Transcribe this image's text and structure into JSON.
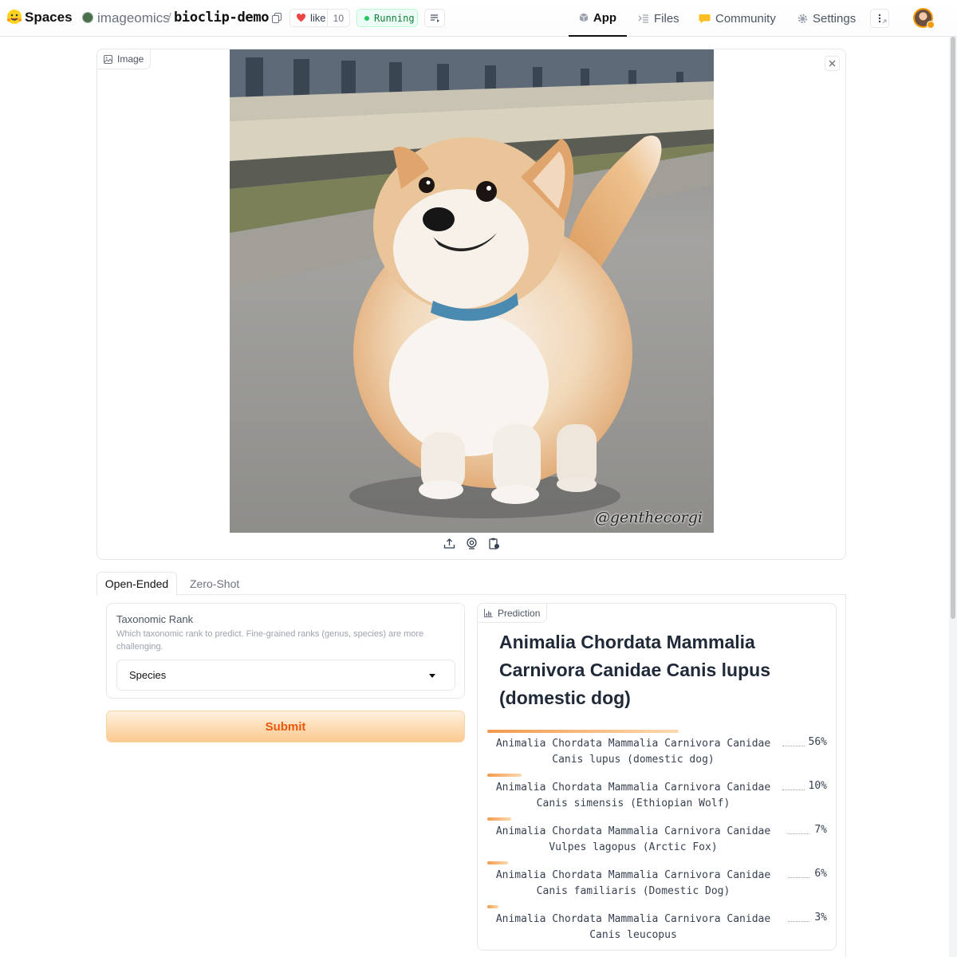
{
  "header": {
    "brand": "Spaces",
    "org": "imageomics",
    "separator": "/",
    "repo": "bioclip-demo",
    "like_label": "like",
    "like_count": "10",
    "status": "Running",
    "nav": {
      "app": "App",
      "files": "Files",
      "community": "Community",
      "settings": "Settings"
    }
  },
  "image_panel": {
    "label": "Image",
    "watermark": "@genthecorgi"
  },
  "tabs": {
    "open_ended": "Open-Ended",
    "zero_shot": "Zero-Shot"
  },
  "form": {
    "rank_title": "Taxonomic Rank",
    "rank_info": "Which taxonomic rank to predict. Fine-grained ranks (genus, species) are more challenging.",
    "rank_value": "Species",
    "submit": "Submit"
  },
  "prediction": {
    "label": "Prediction",
    "top": "Animalia Chordata Mammalia Carnivora Canidae Canis lupus (domestic dog)",
    "results": [
      {
        "line1": "Animalia Chordata Mammalia Carnivora Canidae",
        "line2": "Canis lupus (domestic dog)",
        "pct_label": "56%",
        "confidence": 0.56
      },
      {
        "line1": "Animalia Chordata Mammalia Carnivora Canidae",
        "line2": "Canis simensis (Ethiopian Wolf)",
        "pct_label": "10%",
        "confidence": 0.1
      },
      {
        "line1": "Animalia Chordata Mammalia Carnivora Canidae",
        "line2": "Vulpes lagopus (Arctic Fox)",
        "pct_label": "7%",
        "confidence": 0.07
      },
      {
        "line1": "Animalia Chordata Mammalia Carnivora Canidae",
        "line2": "Canis familiaris (Domestic Dog)",
        "pct_label": "6%",
        "confidence": 0.06
      },
      {
        "line1": "Animalia Chordata Mammalia Carnivora Canidae",
        "line2": "Canis leucopus",
        "pct_label": "3%",
        "confidence": 0.03
      }
    ]
  },
  "colors": {
    "accent": "#f97316",
    "status_green": "#22c55e",
    "like_heart": "#ef4444"
  }
}
